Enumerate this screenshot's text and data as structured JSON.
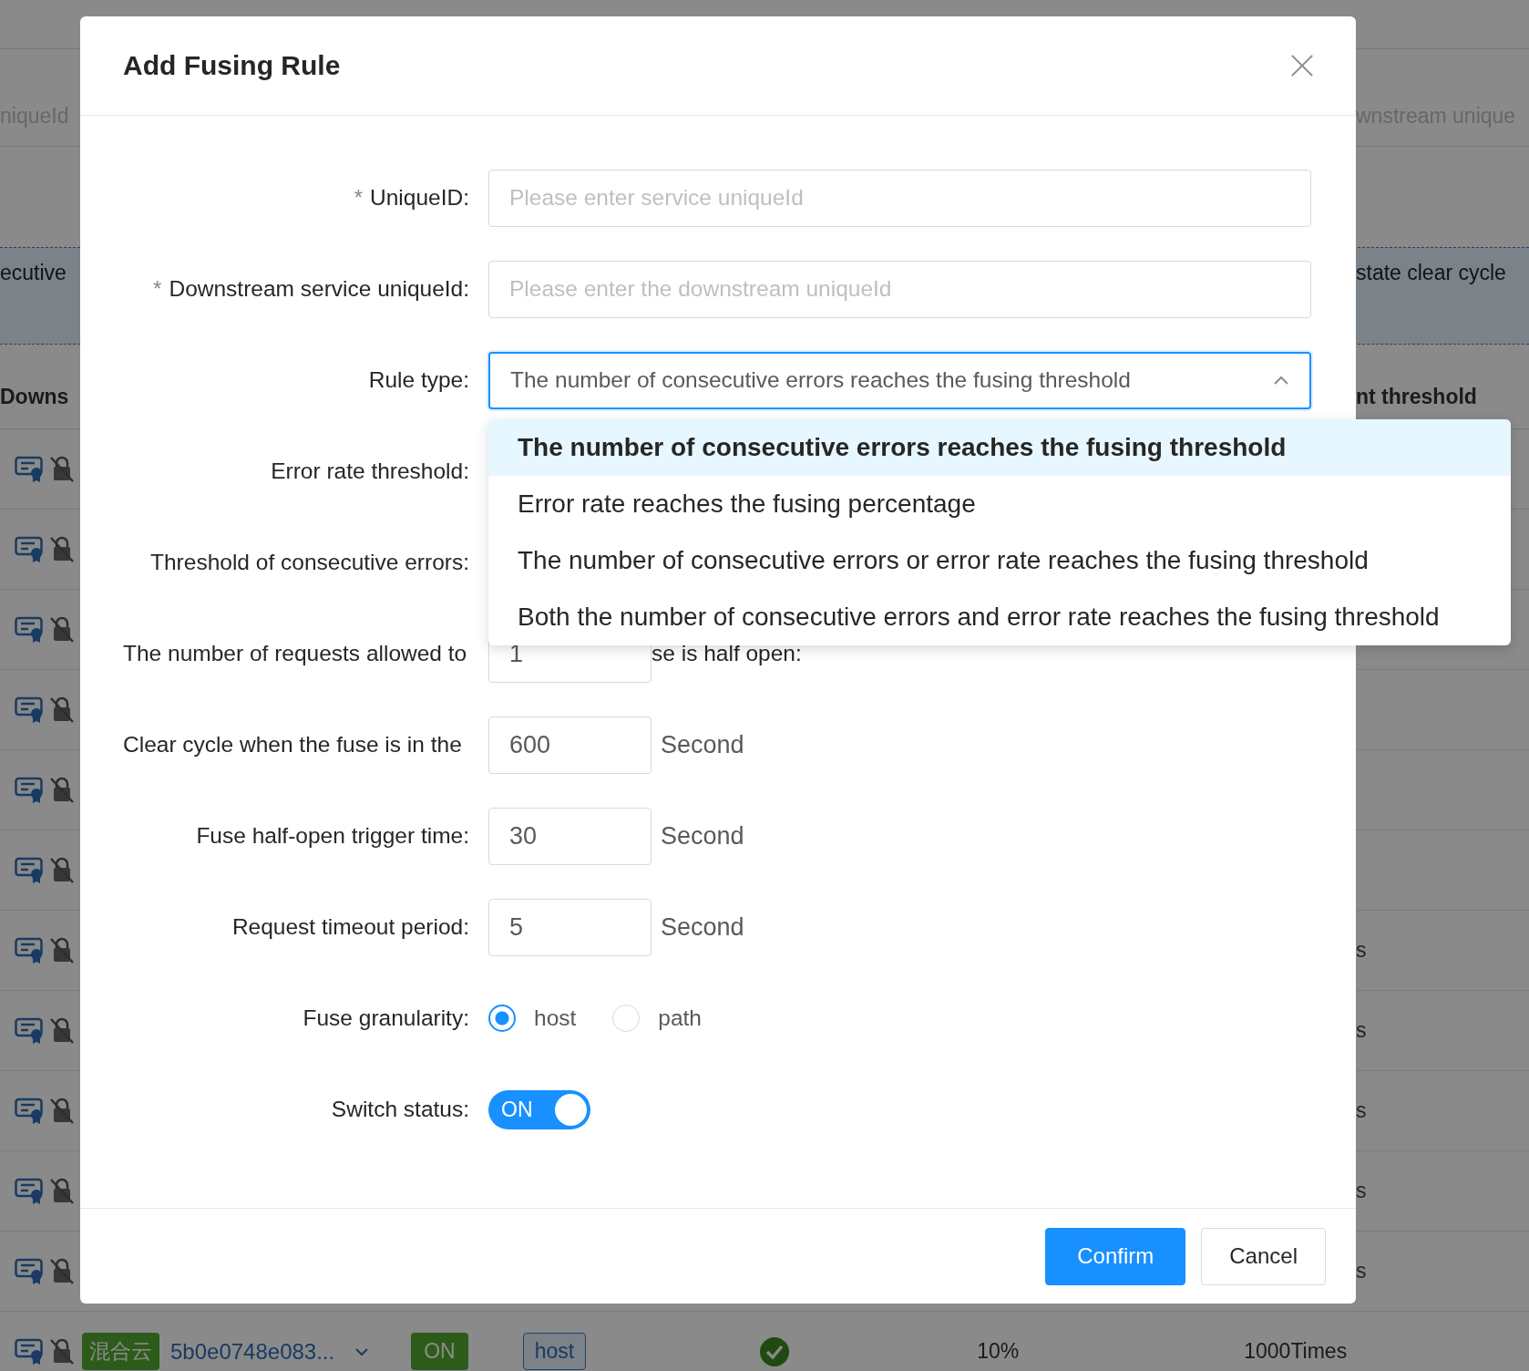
{
  "background": {
    "filter_row": {
      "left": "niqueId",
      "right": "wnstream unique"
    },
    "banner": {
      "left": "ecutive",
      "right": "state clear cycle"
    },
    "header": {
      "left": "Downs",
      "right": "nt threshold"
    },
    "rows": [
      {},
      {},
      {},
      {},
      {},
      {},
      {
        "tail": "s"
      },
      {
        "tail": "s"
      },
      {
        "tail": "s"
      },
      {
        "tail": "s"
      },
      {
        "tail": "s"
      }
    ],
    "last_row": {
      "tag": "混合云",
      "service": "5b0e0748e083...",
      "status": "ON",
      "granularity": "host",
      "healthy": true,
      "error_rate": "10%",
      "threshold": "1000Times"
    }
  },
  "modal": {
    "title": "Add Fusing Rule",
    "fields": [
      {
        "kind": "input",
        "label": "UniqueID:",
        "required_mark": "*",
        "placeholder": "Please enter service uniqueId"
      },
      {
        "kind": "input",
        "label": "Downstream service uniqueId:",
        "required_mark": "*",
        "placeholder": "Please enter the downstream uniqueId"
      },
      {
        "kind": "select",
        "label": "Rule type:",
        "value": "The number of consecutive errors reaches the fusing threshold",
        "expanded": true,
        "options": [
          {
            "label": "The number of consecutive errors reaches the fusing threshold",
            "selected": true
          },
          {
            "label": "Error rate reaches the fusing percentage",
            "selected": false
          },
          {
            "label": "The number of consecutive errors or error rate reaches the fusing threshold",
            "selected": false
          },
          {
            "label": "Both the number of consecutive errors and error rate reaches the fusing threshold",
            "selected": false
          }
        ]
      },
      {
        "kind": "covered",
        "label": "Error rate threshold:"
      },
      {
        "kind": "covered",
        "label": "Threshold of consecutive errors:"
      },
      {
        "kind": "number",
        "label": "The number of requests allowed to",
        "value": "1",
        "label_tail": "se is half open:",
        "overflow": true
      },
      {
        "kind": "number",
        "label": "Clear cycle when the fuse is in the",
        "value": "600",
        "unit": "Second",
        "overflow": true
      },
      {
        "kind": "number",
        "label": "Fuse half-open trigger time:",
        "value": "30",
        "unit": "Second"
      },
      {
        "kind": "number",
        "label": "Request timeout period:",
        "value": "5",
        "unit": "Second"
      },
      {
        "kind": "radio",
        "label": "Fuse granularity:",
        "options": [
          {
            "label": "host",
            "selected": true
          },
          {
            "label": "path",
            "selected": false
          }
        ]
      },
      {
        "kind": "switch",
        "label": "Switch status:",
        "on": true,
        "text": "ON"
      }
    ],
    "buttons": [
      {
        "label": "Confirm",
        "kind": "primary"
      },
      {
        "label": "Cancel",
        "kind": "default"
      }
    ]
  }
}
